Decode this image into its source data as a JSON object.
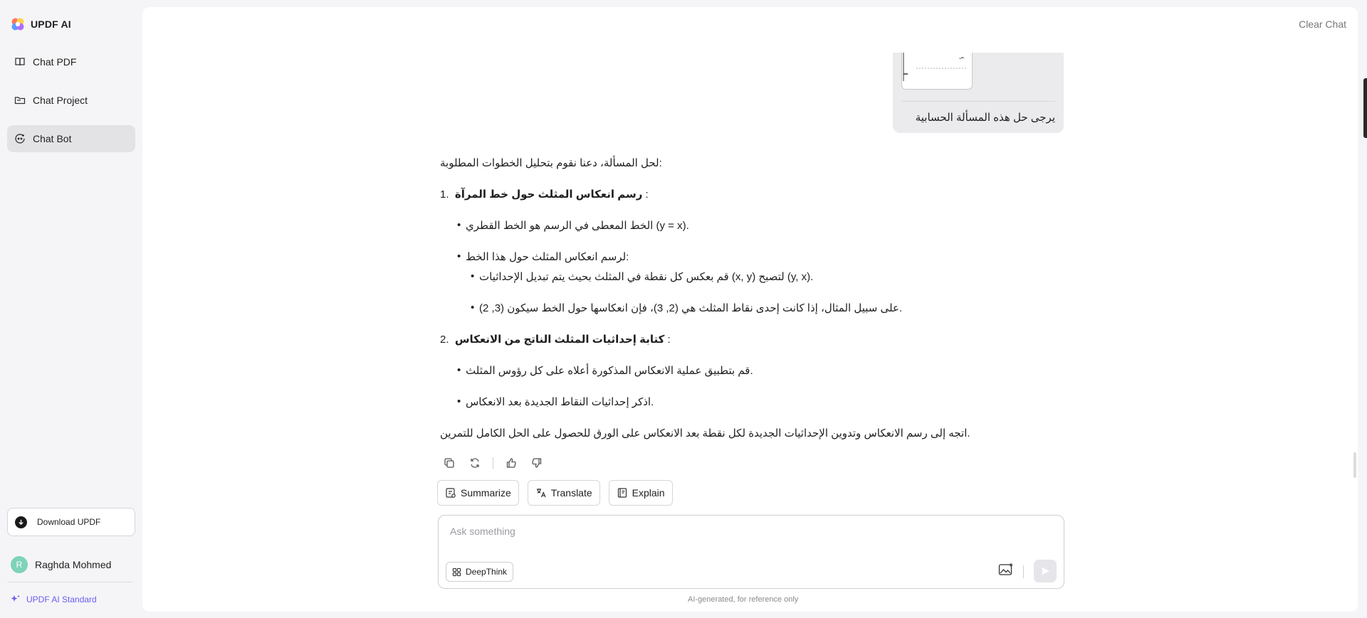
{
  "app": {
    "name": "UPDF AI"
  },
  "sidebar": {
    "items": [
      {
        "label": "Chat PDF",
        "icon": "book-icon",
        "active": false
      },
      {
        "label": "Chat Project",
        "icon": "folder-icon",
        "active": false
      },
      {
        "label": "Chat Bot",
        "icon": "bot-icon",
        "active": true
      }
    ],
    "download_label": "Download UPDF",
    "user": {
      "initial": "R",
      "name": "Raghda Mohmed"
    },
    "plan_label": "UPDF AI Standard"
  },
  "header": {
    "clear_label": "Clear Chat"
  },
  "conversation": {
    "user_message": "يرجى حل هذه المسألة الحسابية",
    "assistant": {
      "intro": "لحل المسألة، دعنا نقوم بتحليل الخطوات المطلوبة:",
      "step1": {
        "number": "1.",
        "title": "رسم انعكاس المثلث حول خط المرآة",
        "suffix": ":"
      },
      "step1_bullets": [
        "الخط المعطى في الرسم هو الخط القطري (y = x).",
        "لرسم انعكاس المثلث حول هذا الخط:"
      ],
      "step1_sub_bullets": [
        "قم بعكس كل نقطة في المثلث بحيث يتم تبديل الإحداثيات (x, y) لتصبح (y, x).",
        "على سبيل المثال، إذا كانت إحدى نقاط المثلث هي (2, 3)، فإن انعكاسها حول الخط سيكون (3, 2)."
      ],
      "step2": {
        "number": "2.",
        "title": "كتابة إحداثيات المثلث الناتج من الانعكاس",
        "suffix": ":"
      },
      "step2_bullets": [
        "قم بتطبيق عملية الانعكاس المذكورة أعلاه على كل رؤوس المثلث.",
        "اذكر إحداثيات النقاط الجديدة بعد الانعكاس."
      ],
      "conclusion": "اتجه إلى رسم الانعكاس وتدوين الإحداثيات الجديدة لكل نقطة بعد الانعكاس على الورق للحصول على الحل الكامل للتمرين."
    }
  },
  "quick_actions": [
    {
      "label": "Summarize",
      "icon": "summarize-icon"
    },
    {
      "label": "Translate",
      "icon": "translate-icon"
    },
    {
      "label": "Explain",
      "icon": "explain-icon"
    }
  ],
  "composer": {
    "placeholder": "Ask something",
    "deepthink_label": "DeepThink"
  },
  "footer": {
    "disclaimer": "AI-generated, for reference only"
  },
  "colors": {
    "accent": "#6a5cf0",
    "active_nav": "#e3e3e6",
    "avatar": "#7ed3b8"
  }
}
